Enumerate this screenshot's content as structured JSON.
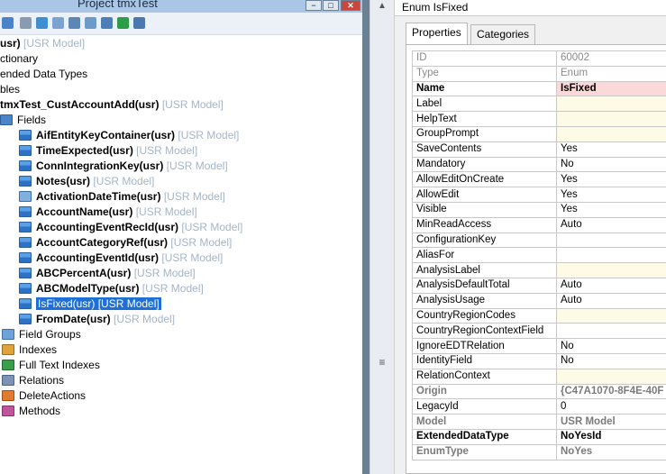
{
  "tree_window": {
    "title": "Project tmxTest"
  },
  "prop_window": {
    "title": "Enum IsFixed",
    "tabs": [
      "Properties",
      "Categories"
    ]
  },
  "tree": {
    "nodes": [
      {
        "label": "usr)",
        "model": "[USR Model]",
        "bold": true
      },
      {
        "label": "ctionary",
        "model": ""
      },
      {
        "label": "ended Data Types",
        "model": ""
      },
      {
        "label": "bles",
        "model": ""
      },
      {
        "label": "tmxTest_CustAccountAdd(usr)",
        "model": "[USR Model]",
        "bold": true
      },
      {
        "label": "Fields",
        "model": ""
      },
      {
        "label": "AifEntityKeyContainer(usr)",
        "model": "[USR Model]",
        "bold": true
      },
      {
        "label": "TimeExpected(usr)",
        "model": "[USR Model]",
        "bold": true
      },
      {
        "label": "ConnIntegrationKey(usr)",
        "model": "[USR Model]",
        "bold": true
      },
      {
        "label": "Notes(usr)",
        "model": "[USR Model]",
        "bold": true
      },
      {
        "label": "ActivationDateTime(usr)",
        "model": "[USR Model]",
        "bold": true
      },
      {
        "label": "AccountName(usr)",
        "model": "[USR Model]",
        "bold": true
      },
      {
        "label": "AccountingEventRecId(usr)",
        "model": "[USR Model]",
        "bold": true
      },
      {
        "label": "AccountCategoryRef(usr)",
        "model": "[USR Model]",
        "bold": true
      },
      {
        "label": "AccountingEventId(usr)",
        "model": "[USR Model]",
        "bold": true
      },
      {
        "label": "ABCPercentA(usr)",
        "model": "[USR Model]",
        "bold": true
      },
      {
        "label": "ABCModelType(usr)",
        "model": "[USR Model]",
        "bold": true
      },
      {
        "label": "IsFixed(usr)",
        "model": "[USR Model]",
        "bold": true
      },
      {
        "label": "FromDate(usr)",
        "model": "[USR Model]",
        "bold": true
      },
      {
        "label": "Field Groups",
        "model": ""
      },
      {
        "label": "Indexes",
        "model": ""
      },
      {
        "label": "Full Text Indexes",
        "model": ""
      },
      {
        "label": "Relations",
        "model": ""
      },
      {
        "label": "DeleteActions",
        "model": ""
      },
      {
        "label": "Methods",
        "model": ""
      }
    ]
  },
  "properties": [
    {
      "key": "ID",
      "value": "60002",
      "style": "gray"
    },
    {
      "key": "Type",
      "value": "Enum",
      "style": "gray"
    },
    {
      "key": "Name",
      "value": "IsFixed",
      "style": "bold",
      "highlight": "red"
    },
    {
      "key": "Label",
      "value": "",
      "highlight": "yellow"
    },
    {
      "key": "HelpText",
      "value": "",
      "highlight": "yellow"
    },
    {
      "key": "GroupPrompt",
      "value": "",
      "highlight": "yellow"
    },
    {
      "key": "SaveContents",
      "value": "Yes"
    },
    {
      "key": "Mandatory",
      "value": "No"
    },
    {
      "key": "AllowEditOnCreate",
      "value": "Yes"
    },
    {
      "key": "AllowEdit",
      "value": "Yes"
    },
    {
      "key": "Visible",
      "value": "Yes"
    },
    {
      "key": "MinReadAccess",
      "value": "Auto"
    },
    {
      "key": "ConfigurationKey",
      "value": ""
    },
    {
      "key": "AliasFor",
      "value": ""
    },
    {
      "key": "AnalysisLabel",
      "value": "",
      "highlight": "yellow"
    },
    {
      "key": "AnalysisDefaultTotal",
      "value": "Auto"
    },
    {
      "key": "AnalysisUsage",
      "value": "Auto"
    },
    {
      "key": "CountryRegionCodes",
      "value": "",
      "highlight": "yellow"
    },
    {
      "key": "CountryRegionContextField",
      "value": ""
    },
    {
      "key": "IgnoreEDTRelation",
      "value": "No"
    },
    {
      "key": "IdentityField",
      "value": "No"
    },
    {
      "key": "RelationContext",
      "value": "",
      "highlight": "yellow"
    },
    {
      "key": "Origin",
      "value": "{C47A1070-8F4E-40F",
      "style": "bgray"
    },
    {
      "key": "LegacyId",
      "value": "0"
    },
    {
      "key": "Model",
      "value": "USR Model",
      "style": "bgray"
    },
    {
      "key": "ExtendedDataType",
      "value": "NoYesId",
      "style": "bold"
    },
    {
      "key": "EnumType",
      "value": "NoYes",
      "style": "bgray"
    }
  ],
  "colors": {
    "selection": "#1e6fd6",
    "model_text": "#a5b5c8",
    "name_highlight": "#fbd9d9",
    "empty_highlight": "#fdfbe5"
  }
}
